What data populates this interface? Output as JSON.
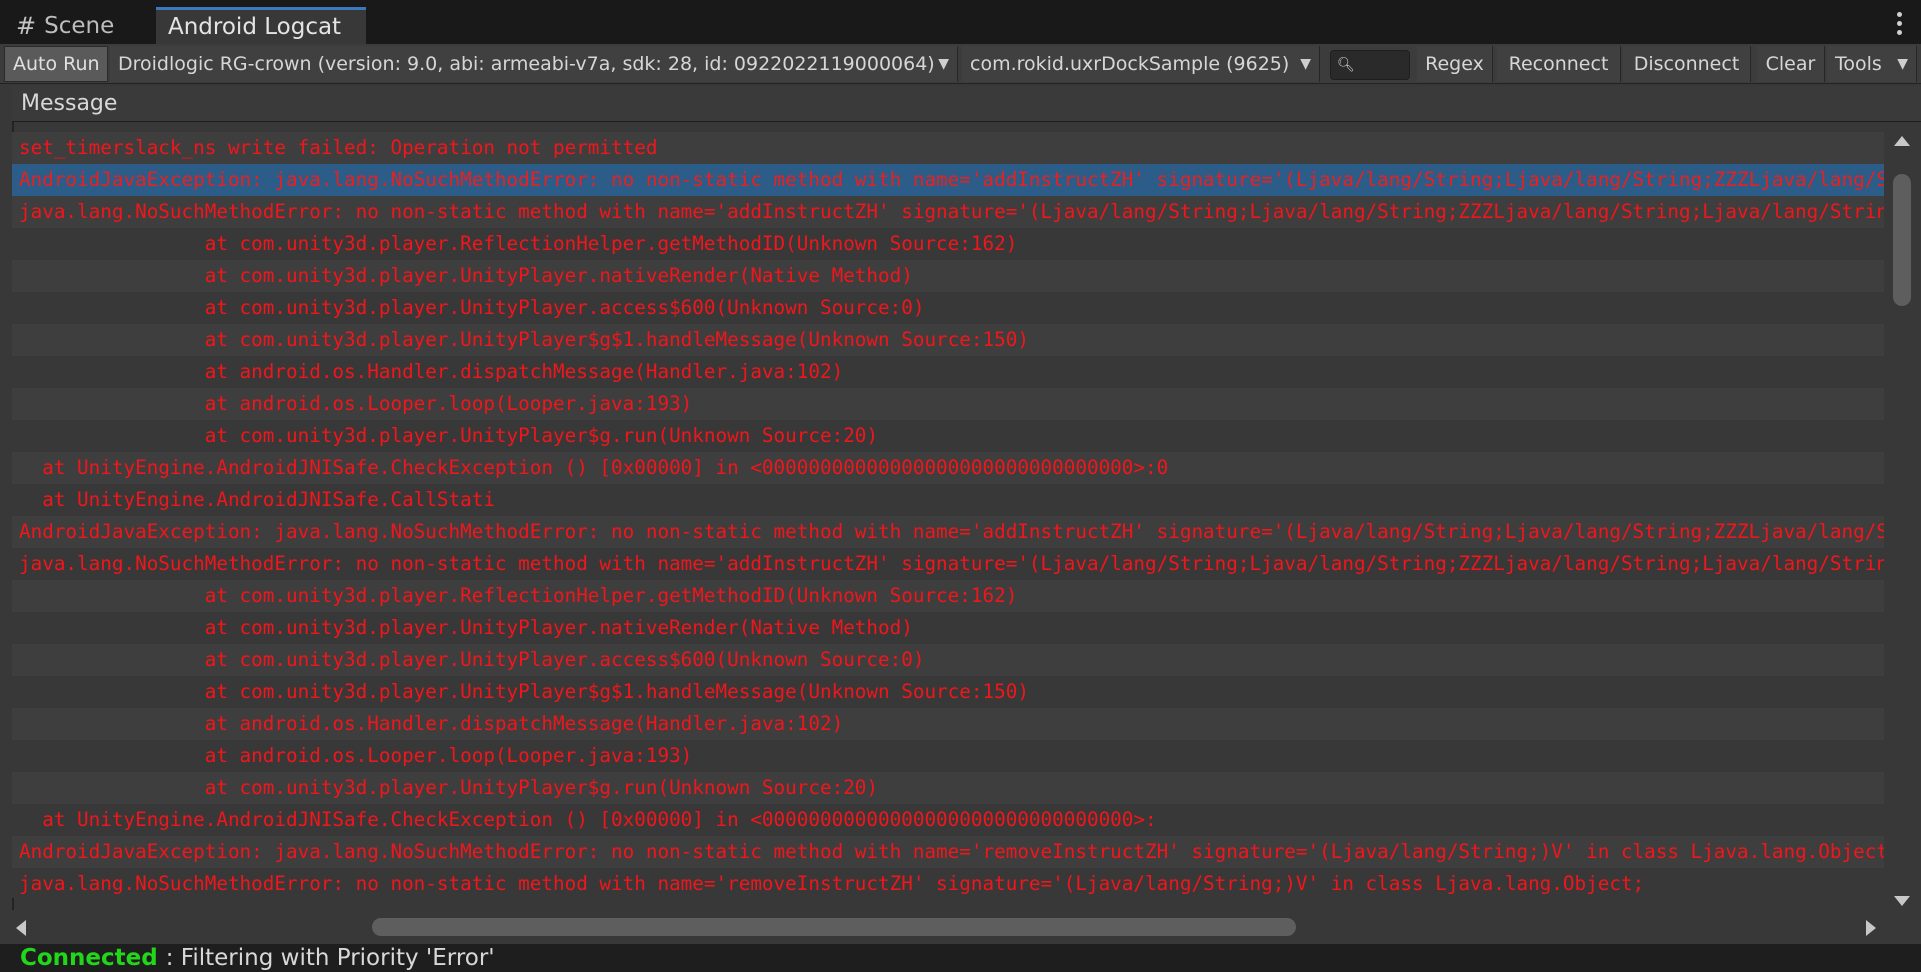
{
  "tabs": [
    {
      "label": "Scene",
      "icon": "grid-icon"
    },
    {
      "label": "Android Logcat",
      "active": true
    }
  ],
  "toolbar": {
    "auto_run": "Auto Run",
    "device": "Droidlogic RG-crown (version: 9.0, abi: armeabi-v7a, sdk: 28, id: 0922022119000064)",
    "package": "com.rokid.uxrDockSample (9625)",
    "search_value": "",
    "regex": "Regex",
    "reconnect": "Reconnect",
    "disconnect": "Disconnect",
    "clear": "Clear",
    "tools": "Tools"
  },
  "columns": {
    "message": "Message"
  },
  "log_rows": [
    "set_timerslack_ns write failed: Operation not permitted",
    "AndroidJavaException: java.lang.NoSuchMethodError: no non-static method with name='addInstructZH' signature='(Ljava/lang/String;Ljava/lang/String;ZZZLjava/lang/String;Ljava/lang/",
    "java.lang.NoSuchMethodError: no non-static method with name='addInstructZH' signature='(Ljava/lang/String;Ljava/lang/String;ZZZLjava/lang/String;Ljava/lang/String;",
    "                at com.unity3d.player.ReflectionHelper.getMethodID(Unknown Source:162)",
    "                at com.unity3d.player.UnityPlayer.nativeRender(Native Method)",
    "                at com.unity3d.player.UnityPlayer.access$600(Unknown Source:0)",
    "                at com.unity3d.player.UnityPlayer$g$1.handleMessage(Unknown Source:150)",
    "                at android.os.Handler.dispatchMessage(Handler.java:102)",
    "                at android.os.Looper.loop(Looper.java:193)",
    "                at com.unity3d.player.UnityPlayer$g.run(Unknown Source:20)",
    "  at UnityEngine.AndroidJNISafe.CheckException () [0x00000] in <00000000000000000000000000000000>:0",
    "  at UnityEngine.AndroidJNISafe.CallStati",
    "AndroidJavaException: java.lang.NoSuchMethodError: no non-static method with name='addInstructZH' signature='(Ljava/lang/String;Ljava/lang/String;ZZZLjava/lang/String;Ljava/lang/",
    "java.lang.NoSuchMethodError: no non-static method with name='addInstructZH' signature='(Ljava/lang/String;Ljava/lang/String;ZZZLjava/lang/String;Ljava/lang/String;",
    "                at com.unity3d.player.ReflectionHelper.getMethodID(Unknown Source:162)",
    "                at com.unity3d.player.UnityPlayer.nativeRender(Native Method)",
    "                at com.unity3d.player.UnityPlayer.access$600(Unknown Source:0)",
    "                at com.unity3d.player.UnityPlayer$g$1.handleMessage(Unknown Source:150)",
    "                at android.os.Handler.dispatchMessage(Handler.java:102)",
    "                at android.os.Looper.loop(Looper.java:193)",
    "                at com.unity3d.player.UnityPlayer$g.run(Unknown Source:20)",
    "  at UnityEngine.AndroidJNISafe.CheckException () [0x00000] in <00000000000000000000000000000000>:",
    "AndroidJavaException: java.lang.NoSuchMethodError: no non-static method with name='removeInstructZH' signature='(Ljava/lang/String;)V' in class Ljava.lang.Object;",
    "java.lang.NoSuchMethodError: no non-static method with name='removeInstructZH' signature='(Ljava/lang/String;)V' in class Ljava.lang.Object;"
  ],
  "selected_row": 1,
  "status": {
    "connected": "Connected",
    "message": ": Filtering with Priority 'Error'"
  },
  "colors": {
    "error_text": "#f0161b",
    "selection": "#2b5d88",
    "connected": "#22d61a",
    "tab_accent": "#3a79bb"
  }
}
